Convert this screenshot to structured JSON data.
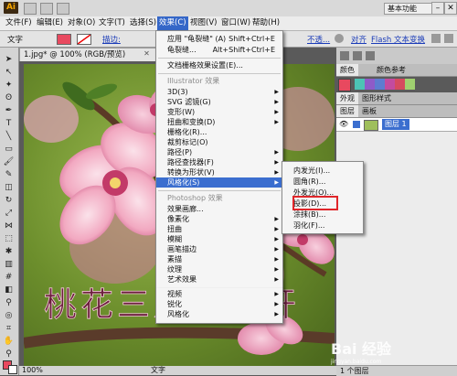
{
  "app": {
    "logo": "Ai",
    "essentials_label": "基本功能",
    "win_min": "–",
    "win_max": "□",
    "win_close": "✕"
  },
  "menubar": {
    "items": [
      {
        "label": "文件(F)"
      },
      {
        "label": "编辑(E)"
      },
      {
        "label": "对象(O)"
      },
      {
        "label": "文字(T)"
      },
      {
        "label": "选择(S)"
      },
      {
        "label": "效果(C)"
      },
      {
        "label": "视图(V)"
      },
      {
        "label": "窗口(W)"
      },
      {
        "label": "帮助(H)"
      }
    ]
  },
  "controlbar": {
    "text_label": "文字",
    "stroke_label": "描边:",
    "opacity_label": "不透...",
    "align_label": "对齐",
    "flash_label": "Flash 文本",
    "transform_label": "变换"
  },
  "document": {
    "tab_title": "1.jpg* @ 100% (RGB/预览)",
    "close": "✕",
    "overlay_text": "桃花三月桃花开"
  },
  "statusbar": {
    "zoom": "100%",
    "mode": "文字"
  },
  "panels": {
    "tab_color": "颜色",
    "tab_color_guide": "颜色参考",
    "tab_appearance": "外观",
    "tab_graphic_styles": "图形样式",
    "tab_layers": "图层",
    "tab_artboards": "画板",
    "layer_name": "图层 1",
    "layers_count": "1 个图层"
  },
  "effect_menu": {
    "items": [
      {
        "label": "应用 \"龟裂缝\" (A)",
        "shortcut": "Shift+Ctrl+E"
      },
      {
        "label": "龟裂缝...",
        "shortcut": "Alt+Shift+Ctrl+E"
      },
      {
        "label": "文档栅格效果设置(E)..."
      },
      {
        "label": "Illustrator 效果"
      },
      {
        "label": "3D(3)"
      },
      {
        "label": "SVG 滤镜(G)"
      },
      {
        "label": "变形(W)"
      },
      {
        "label": "扭曲和变换(D)"
      },
      {
        "label": "栅格化(R)..."
      },
      {
        "label": "裁剪标记(O)"
      },
      {
        "label": "路径(P)"
      },
      {
        "label": "路径查找器(F)"
      },
      {
        "label": "转换为形状(V)"
      },
      {
        "label": "风格化(S)"
      },
      {
        "label": "Photoshop 效果"
      },
      {
        "label": "效果画廊..."
      },
      {
        "label": "像素化"
      },
      {
        "label": "扭曲"
      },
      {
        "label": "模糊"
      },
      {
        "label": "画笔描边"
      },
      {
        "label": "素描"
      },
      {
        "label": "纹理"
      },
      {
        "label": "艺术效果"
      },
      {
        "label": "视频"
      },
      {
        "label": "锐化"
      },
      {
        "label": "风格化"
      }
    ]
  },
  "stylize_submenu": {
    "items": [
      {
        "label": "内发光(I)..."
      },
      {
        "label": "圆角(R)..."
      },
      {
        "label": "外发光(O)..."
      },
      {
        "label": "投影(D)..."
      },
      {
        "label": "涂抹(B)..."
      },
      {
        "label": "羽化(F)..."
      }
    ]
  },
  "watermark": {
    "text": "Bai 经验",
    "sub": "jingyan.baidu.com"
  },
  "colors": {
    "menu_highlight": "#3b6ecf",
    "callout_red": "#e0262a",
    "fill_swatch": "#e8495f"
  }
}
